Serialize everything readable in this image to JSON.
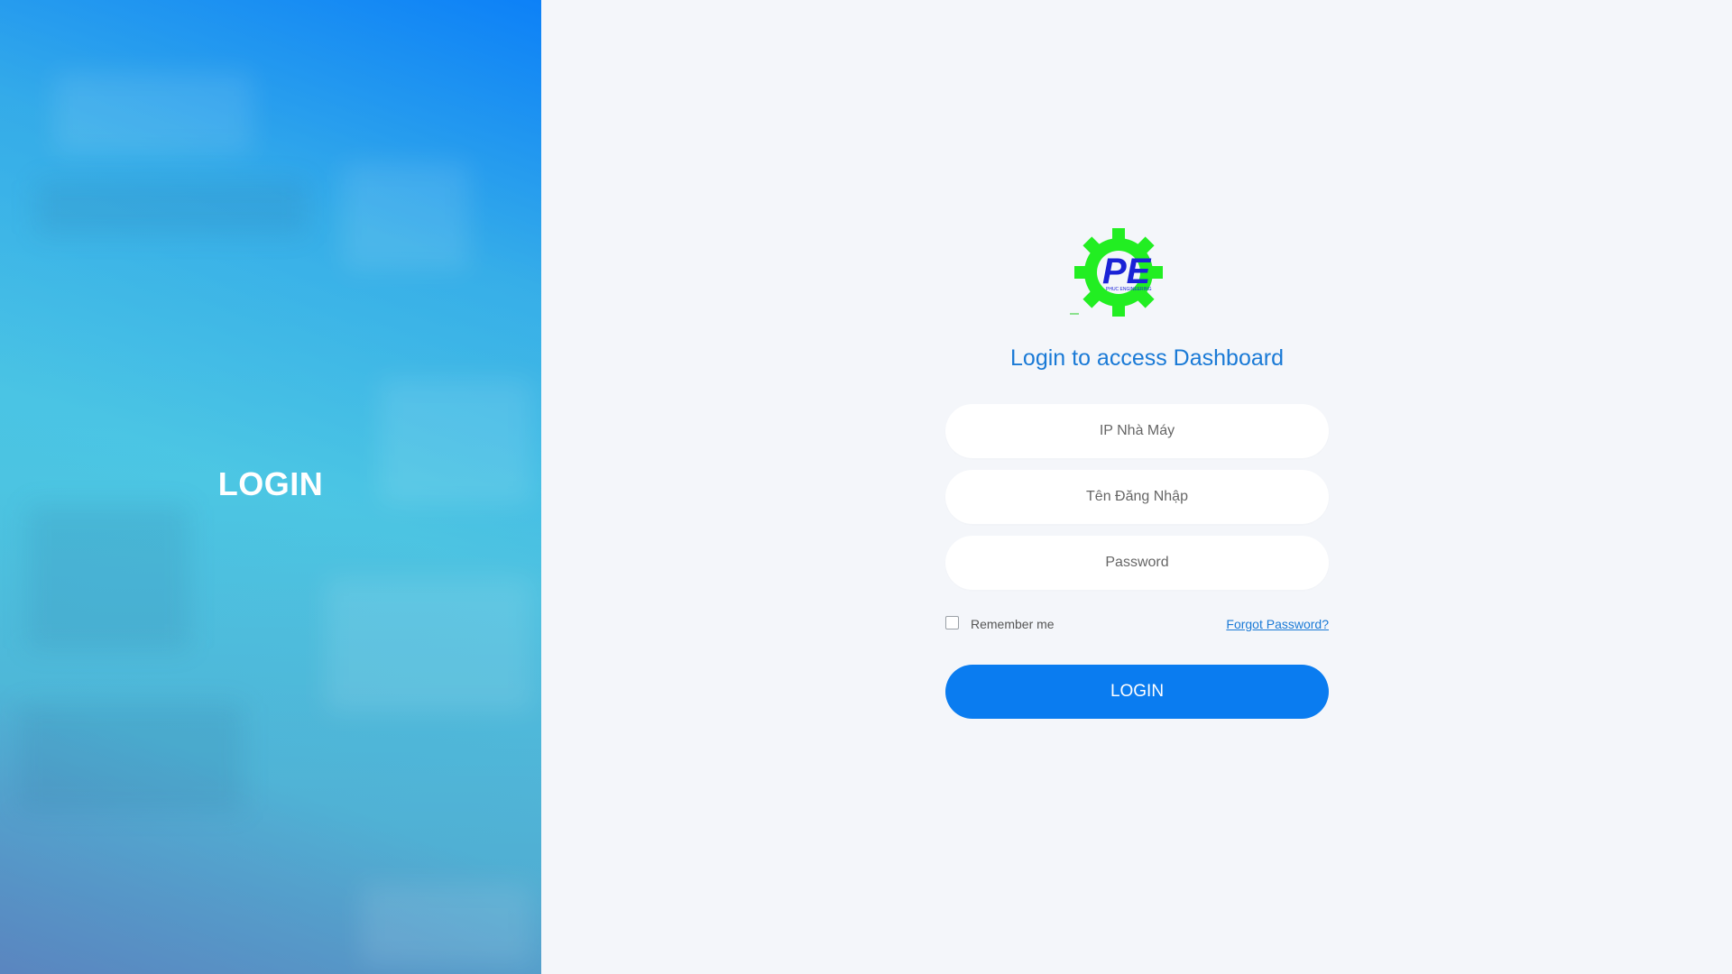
{
  "left_panel": {
    "title": "LOGIN"
  },
  "logo": {
    "text": "PE",
    "subtext": "PHUC ENGINEERING"
  },
  "form": {
    "heading": "Login to access Dashboard",
    "ip_placeholder": "IP Nhà Máy",
    "username_placeholder": "Tên Đăng Nhập",
    "password_placeholder": "Password",
    "remember_label": "Remember me",
    "forgot_label": "Forgot Password?",
    "submit_label": "LOGIN"
  },
  "colors": {
    "accent": "#0a7cf0",
    "heading": "#1a7ad6",
    "logo_gear": "#22ee22",
    "logo_text": "#1a22d6"
  }
}
